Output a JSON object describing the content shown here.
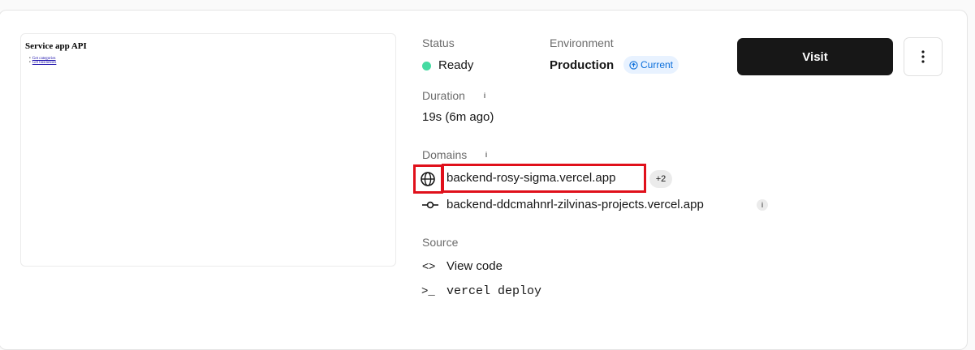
{
  "preview": {
    "title": "Service app API",
    "links": [
      "Get categories",
      "Get businesses"
    ]
  },
  "status": {
    "label": "Status",
    "value": "Ready",
    "color": "#45dba2"
  },
  "environment": {
    "label": "Environment",
    "value": "Production",
    "badge": "Current",
    "badge_icon": "arrow-up-circle-icon"
  },
  "actions": {
    "visit_label": "Visit",
    "more_icon": "vertical-ellipsis-icon"
  },
  "duration": {
    "label": "Duration",
    "info": "i",
    "value": "19s (6m ago)"
  },
  "domains": {
    "label": "Domains",
    "info": "i",
    "primary": "backend-rosy-sigma.vercel.app",
    "extra_count": "+2",
    "secondary": "backend-ddcmahnrl-zilvinas-projects.vercel.app",
    "secondary_info": "i"
  },
  "source": {
    "label": "Source",
    "view_code": "View code",
    "view_code_icon": "<>",
    "command_icon": ">_",
    "command": "vercel deploy"
  },
  "colors": {
    "accent": "#0a6edb",
    "highlight": "#e0101b",
    "button": "#171717"
  }
}
